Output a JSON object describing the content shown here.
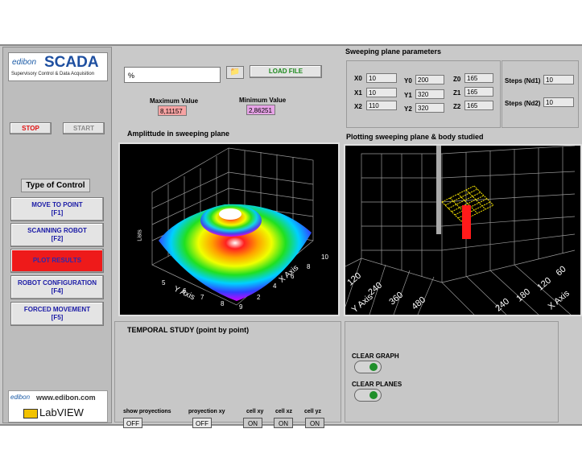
{
  "logo": {
    "edibon": "edibon",
    "scada": "SCADA",
    "subtitle": "Supervisory Control & Data Acquisition"
  },
  "buttons": {
    "stop": "STOP",
    "start": "START"
  },
  "control": {
    "title": "Type of Control",
    "items": [
      {
        "label": "MOVE TO POINT",
        "key": "[F1]"
      },
      {
        "label": "SCANNING ROBOT",
        "key": "[F2]"
      },
      {
        "label": "PLOT RESULTS",
        "key": ""
      },
      {
        "label": "ROBOT CONFIGURATION",
        "key": "[F4]"
      },
      {
        "label": "FORCED MOVEMENT",
        "key": "[F5]"
      }
    ]
  },
  "footer": {
    "website": "www.edibon.com",
    "labview": "LabVIEW"
  },
  "file": {
    "path": "%",
    "load_label": "LOAD FILE"
  },
  "values": {
    "max_label": "Maximum Value",
    "max": "8,11157",
    "min_label": "Minimum Value",
    "min": "2,86251"
  },
  "sweep": {
    "title": "Sweeping plane parameters",
    "x0_label": "X0",
    "x0": "10",
    "x1_label": "X1",
    "x1": "10",
    "x2_label": "X2",
    "x2": "110",
    "y0_label": "Y0",
    "y0": "200",
    "y1_label": "Y1",
    "y1": "320",
    "y2_label": "Y2",
    "y2": "320",
    "z0_label": "Z0",
    "z0": "165",
    "z1_label": "Z1",
    "z1": "165",
    "z2_label": "Z2",
    "z2": "165",
    "nd1_label": "Steps (Nd1)",
    "nd1": "10",
    "nd2_label": "Steps (Nd2)",
    "nd2": "10"
  },
  "plot1": {
    "title": "Amplittude in sweeping plane",
    "xaxis": "X Axis",
    "yaxis": "Y Axis",
    "zaxis": "Lists",
    "ticks": [
      "5",
      "6",
      "7",
      "8",
      "9",
      "2",
      "4",
      "6",
      "8",
      "10"
    ]
  },
  "plot2": {
    "title": "Plotting sweeping plane & body studied",
    "ticks": [
      "120",
      "240",
      "360",
      "480",
      "60",
      "120",
      "180",
      "240"
    ],
    "xaxis": "X Axis",
    "yaxis": "Y Axis"
  },
  "temporal": {
    "title": "TEMPORAL STUDY (point by point)",
    "show_proy_label": "show proyections",
    "show_proy": "OFF",
    "proy_xy_label": "proyection xy",
    "proy_xy": "OFF",
    "cell_xy_label": "cell xy",
    "cell_xy": "ON",
    "cell_xz_label": "cell xz",
    "cell_xz": "ON",
    "cell_yz_label": "cell yz",
    "cell_yz": "ON"
  },
  "clear": {
    "graph": "CLEAR GRAPH",
    "planes": "CLEAR PLANES"
  }
}
